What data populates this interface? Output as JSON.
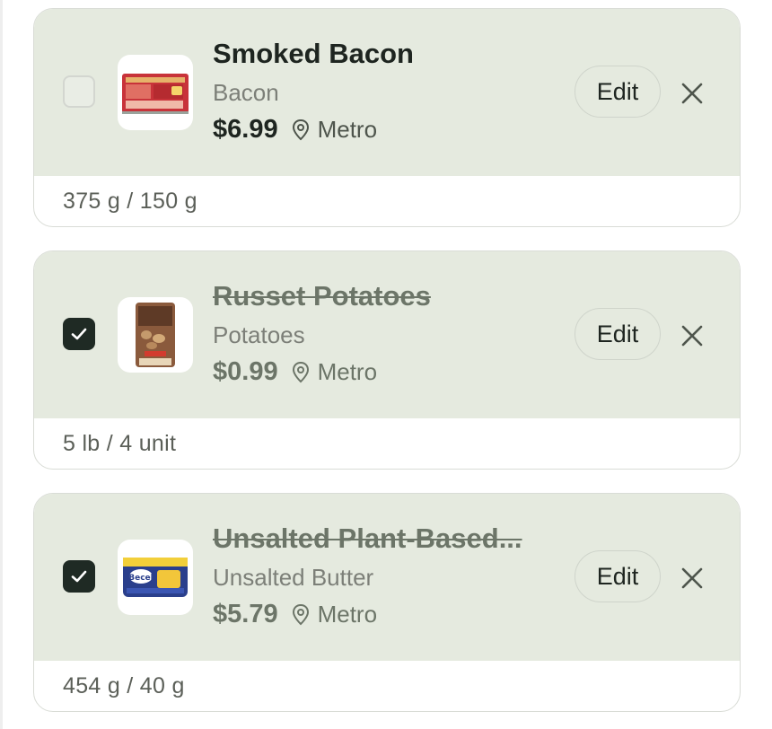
{
  "items": [
    {
      "name": "Smoked Bacon",
      "category": "Bacon",
      "price": "$6.99",
      "store": "Metro",
      "quantity": "375 g / 150 g",
      "checked": false,
      "edit_label": "Edit",
      "thumb_icon": "bacon-package-image"
    },
    {
      "name": "Russet Potatoes",
      "category": "Potatoes",
      "price": "$0.99",
      "store": "Metro",
      "quantity": "5 lb / 4 unit",
      "checked": true,
      "edit_label": "Edit",
      "thumb_icon": "potato-bag-image"
    },
    {
      "name": "Unsalted Plant-Based...",
      "category": "Unsalted Butter",
      "price": "$5.79",
      "store": "Metro",
      "quantity": "454 g / 40 g",
      "checked": true,
      "edit_label": "Edit",
      "thumb_icon": "becel-tub-image",
      "thumb_brand": "Becel"
    }
  ],
  "colors": {
    "card_background": "#e5eadf",
    "checkbox_checked": "#1f2a24",
    "text_primary": "#1e2520",
    "text_muted": "#6c7568"
  }
}
